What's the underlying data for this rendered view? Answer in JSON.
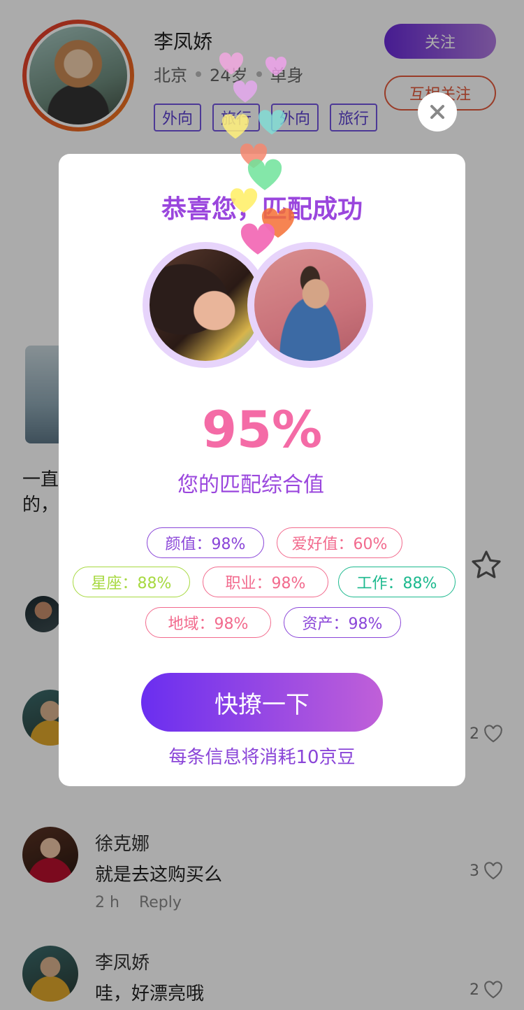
{
  "profile": {
    "name": "李凤娇",
    "city": "北京",
    "age": "24岁",
    "status": "单身",
    "tags": [
      "外向",
      "旅行",
      "外向",
      "旅行"
    ],
    "follow_label": "关注",
    "mutual_label": "互相关注"
  },
  "post": {
    "text_line1": "一直",
    "text_line2": "的，"
  },
  "comments": [
    {
      "name": "徐克娜",
      "text": "就是去这购买么",
      "time": "2 h",
      "reply": "Reply",
      "likes": "3"
    },
    {
      "name": "李凤娇",
      "text": "哇，好漂亮哦",
      "likes": "2"
    }
  ],
  "hidden_comment_likes": "2",
  "modal": {
    "title": "恭喜您，匹配成功",
    "percent": "95%",
    "percent_label": "您的匹配综合值",
    "chips": [
      {
        "label": "颜值：98%",
        "color": "#8a45d8"
      },
      {
        "label": "爱好值：60%",
        "color": "#f26a8d"
      },
      {
        "label": "星座：88%",
        "color": "#a7d940"
      },
      {
        "label": "职业：98%",
        "color": "#f26a8d"
      },
      {
        "label": "工作：88%",
        "color": "#1cb98e"
      },
      {
        "label": "地域：98%",
        "color": "#f26a8d"
      },
      {
        "label": "资产：98%",
        "color": "#8a45d8"
      }
    ],
    "cta_label": "快撩一下",
    "cost_text": "每条信息将消耗10京豆"
  },
  "colors": {
    "accent_purple": "#9a46dd",
    "accent_pink": "#f46ba6",
    "overlay": "rgba(0,0,0,0.33)"
  },
  "floating_hearts": [
    {
      "color": "#f6a8e4"
    },
    {
      "color": "#f3a2ef"
    },
    {
      "color": "#e8a9f2"
    },
    {
      "color": "#7fe0d7"
    },
    {
      "color": "#fff07a"
    },
    {
      "color": "#f4876e"
    },
    {
      "color": "#6fe39a"
    },
    {
      "color": "#ffef6b"
    },
    {
      "color": "#f46e34"
    },
    {
      "color": "#f26bb6"
    }
  ]
}
